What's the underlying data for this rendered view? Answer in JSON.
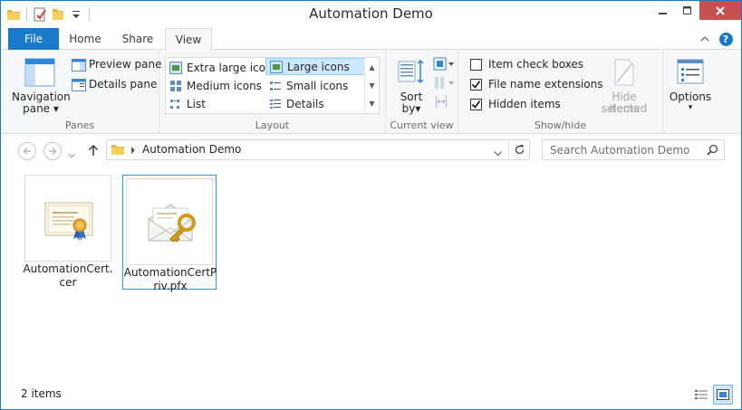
{
  "window": {
    "title": "Automation Demo"
  },
  "quick_access": {
    "icons": [
      "folder-icon",
      "properties-icon",
      "new-folder-icon",
      "customize-dropdown-icon"
    ]
  },
  "tabs": {
    "file": "File",
    "home": "Home",
    "share": "Share",
    "view": "View"
  },
  "ribbon": {
    "panes": {
      "navigation_pane": "Navigation",
      "navigation_pane_2": "pane",
      "preview_pane": "Preview pane",
      "details_pane": "Details pane",
      "group_label": "Panes"
    },
    "layout": {
      "items": [
        "Extra large icons",
        "Large icons",
        "Medium icons",
        "Small icons",
        "List",
        "Details"
      ],
      "selected": "Large icons",
      "group_label": "Layout"
    },
    "current_view": {
      "sort_by": "Sort",
      "sort_by_2": "by",
      "group_label": "Current view"
    },
    "show_hide": {
      "item_check_boxes": "Item check boxes",
      "file_name_extensions": "File name extensions",
      "hidden_items": "Hidden items",
      "hide_selected": "Hide selected",
      "hide_selected_2": "items",
      "group_label": "Show/hide",
      "checked": {
        "item_check_boxes": false,
        "file_name_extensions": true,
        "hidden_items": true
      }
    },
    "options": {
      "label": "Options"
    }
  },
  "address": {
    "path": "Automation Demo"
  },
  "search": {
    "placeholder": "Search Automation Demo"
  },
  "files": [
    {
      "name": "AutomationCert.cer",
      "line1": "AutomationCert.",
      "line2": "cer",
      "selected": false
    },
    {
      "name": "AutomationCertPriv.pfx",
      "line1": "AutomationCertP",
      "line2": "riv.pfx",
      "selected": true
    }
  ],
  "status": {
    "item_count": "2 items"
  },
  "colors": {
    "accent": "#1979ca",
    "close": "#c75050",
    "selection": "#cce8ff",
    "selection_border": "#26a0da"
  }
}
